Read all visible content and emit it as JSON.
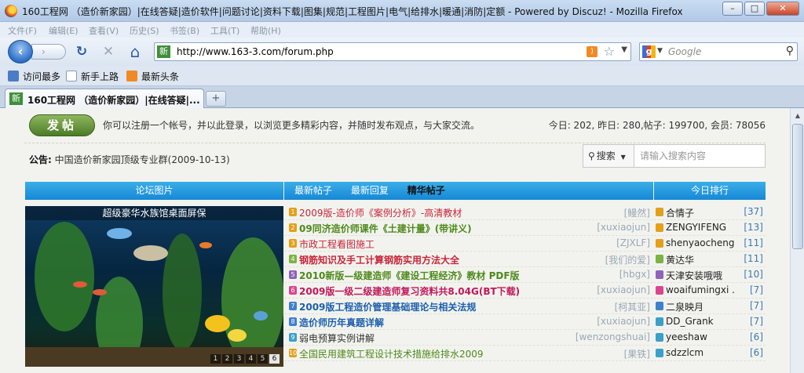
{
  "window": {
    "title": "160工程网 （造价新家园）|在线答疑|造价软件|问题讨论|资料下载|图集|规范|工程图片|电气|给排水|暖通|消防|定额 - Powered by Discuz! - Mozilla Firefox",
    "minimize_label": "–",
    "maximize_label": "□",
    "close_label": "✕"
  },
  "menu": [
    "文件(F)",
    "编辑(E)",
    "查看(V)",
    "历史(S)",
    "书签(B)",
    "工具(T)",
    "帮助(H)"
  ],
  "nav": {
    "back_glyph": "‹",
    "forward_glyph": "›",
    "reload_glyph": "↻",
    "stop_glyph": "✕",
    "home_glyph": "⌂",
    "site_icon_text": "新",
    "url": "http://www.163-3.com/forum.php",
    "rss_glyph": ")",
    "star_glyph": "☆",
    "dropdown_glyph": "▼",
    "search_engine_glyph": "g",
    "search_placeholder": "Google",
    "search_glyph": "⚲"
  },
  "bookmarks": [
    {
      "label": "访问最多",
      "icon": "bookmark-icon"
    },
    {
      "label": "新手上路",
      "icon": "page-icon"
    },
    {
      "label": "最新头条",
      "icon": "rss-icon"
    }
  ],
  "tabs": {
    "active_label": "160工程网 （造价新家园）|在线答疑|...",
    "new_tab_label": "+"
  },
  "page": {
    "post_button": "发帖",
    "intro": "你可以注册一个帐号，并以此登录，以浏览更多精彩内容，并随时发布观点，与大家交流。",
    "stats": "今日: 202, 昨日: 280,帖子: 199700, 会员: 78056",
    "notice_label": "公告:",
    "notice_text": "中国造价新家园顶级专业群(2009-10-13)",
    "search_type": "搜索",
    "search_placeholder": "请输入搜索内容"
  },
  "columns": {
    "left_header": "论坛图片",
    "mid_tabs": [
      "最新帖子",
      "最新回复",
      "精华帖子"
    ],
    "right_header": "今日排行"
  },
  "photo": {
    "caption": "超级豪华水族馆桌面屏保",
    "pages": [
      "1",
      "2",
      "3",
      "4",
      "5",
      "6"
    ],
    "active_page": "6"
  },
  "threads": [
    {
      "num": "1",
      "title": "2009版-造价师《案例分析》-高清教材",
      "author": "[鳗然]",
      "color": "#c8263b",
      "bold": false,
      "icon_color": "#e2a11a"
    },
    {
      "num": "2",
      "title": "09同济造价师课件《土建计量》(带讲义)",
      "author": "[xuxiaojun]",
      "color": "#4f8a1d",
      "bold": true,
      "icon_color": "#e2a11a"
    },
    {
      "num": "3",
      "title": "市政工程看图施工",
      "author": "[ZJXLF]",
      "color": "#c8263b",
      "bold": false,
      "icon_color": "#e2a11a"
    },
    {
      "num": "4",
      "title": "钢筋知识及手工计算钢筋实用方法大全",
      "author": "[我们的爱]",
      "color": "#c8263b",
      "bold": true,
      "icon_color": "#7cb342"
    },
    {
      "num": "5",
      "title": "2010新版—级建造师《建设工程经济》教材 PDF版",
      "author": "[hbgx]",
      "color": "#4f8a1d",
      "bold": true,
      "icon_color": "#8e63b8"
    },
    {
      "num": "6",
      "title": "2009版一级二级建造师复习资料共8.04G(BT下载)",
      "author": "[xuxiaojun]",
      "color": "#c2185b",
      "bold": true,
      "icon_color": "#d9468f"
    },
    {
      "num": "7",
      "title": "2009版工程造价管理基础理论与相关法规",
      "author": "[柯其亚]",
      "color": "#1c5fae",
      "bold": true,
      "icon_color": "#3f7fd0"
    },
    {
      "num": "8",
      "title": "造价师历年真题详解",
      "author": "[xuxiaojun]",
      "color": "#1c5fae",
      "bold": true,
      "icon_color": "#3f7fd0"
    },
    {
      "num": "9",
      "title": "弱电预算实例讲解",
      "author": "[wenzongshuai]",
      "color": "#333333",
      "bold": false,
      "icon_color": "#3aa0c9"
    },
    {
      "num": "10",
      "title": "全国民用建筑工程设计技术措施给排水2009",
      "author": "[果铁]",
      "color": "#4f8a1d",
      "bold": false,
      "icon_color": "#e2a11a"
    }
  ],
  "ranking": [
    {
      "name": "合情子",
      "count": "[37]",
      "icon_color": "#e2a11a"
    },
    {
      "name": "ZENGYIFENG",
      "count": "[13]",
      "icon_color": "#e2a11a"
    },
    {
      "name": "shenyaocheng",
      "count": "[11]",
      "icon_color": "#e2a11a"
    },
    {
      "name": "黄达华",
      "count": "[11]",
      "icon_color": "#7cb342"
    },
    {
      "name": "天津安装哦哦",
      "count": "[10]",
      "icon_color": "#8e63b8"
    },
    {
      "name": "woaifumingxi ...",
      "count": "[7]",
      "icon_color": "#d9468f"
    },
    {
      "name": "二泉映月",
      "count": "[7]",
      "icon_color": "#3f7fd0"
    },
    {
      "name": "DD_Grank",
      "count": "[7]",
      "icon_color": "#3aa0c9"
    },
    {
      "name": "yeeshaw",
      "count": "[6]",
      "icon_color": "#3aa0c9"
    },
    {
      "name": "sdzzlcm",
      "count": "[6]",
      "icon_color": "#3aa0c9"
    }
  ]
}
